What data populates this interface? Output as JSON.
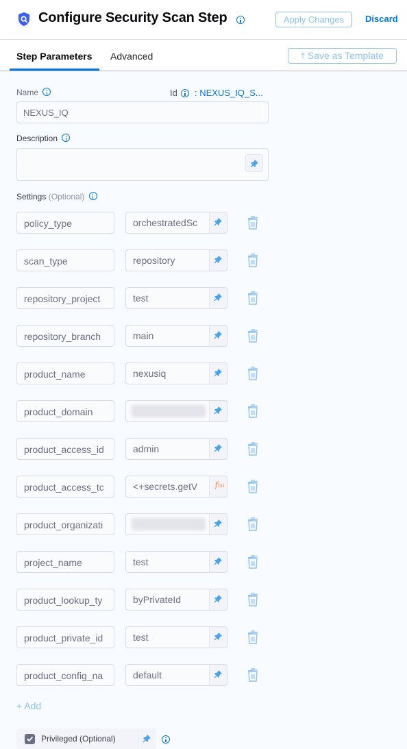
{
  "header": {
    "icon": "security-shield-icon",
    "title": "Configure Security Scan Step",
    "apply_label": "Apply Changes",
    "discard_label": "Discard"
  },
  "tabs": [
    {
      "label": "Step Parameters",
      "active": true
    },
    {
      "label": "Advanced",
      "active": false
    }
  ],
  "save_template_label": "Save as Template",
  "form": {
    "name_label": "Name",
    "name_value": "NEXUS_IQ",
    "id_label": "Id",
    "id_value": ": NEXUS_IQ_S...",
    "description_label": "Description",
    "description_value": "",
    "settings_label": "Settings",
    "settings_optional": "(Optional)"
  },
  "settings": [
    {
      "key": "policy_type",
      "value": "orchestratedSc",
      "mode": "pin"
    },
    {
      "key": "scan_type",
      "value": "repository",
      "mode": "pin"
    },
    {
      "key": "repository_project",
      "value": "test",
      "mode": "pin"
    },
    {
      "key": "repository_branch",
      "value": "main",
      "mode": "pin"
    },
    {
      "key": "product_name",
      "value": "nexusiq",
      "mode": "pin"
    },
    {
      "key": "product_domain",
      "value": "",
      "mode": "pin",
      "redacted": true
    },
    {
      "key": "product_access_id",
      "value": "admin",
      "mode": "pin"
    },
    {
      "key": "product_access_tc",
      "value": "<+secrets.getV",
      "mode": "expression"
    },
    {
      "key": "product_organizati",
      "value": "",
      "mode": "pin",
      "redacted": true
    },
    {
      "key": "project_name",
      "value": "test",
      "mode": "pin"
    },
    {
      "key": "product_lookup_ty",
      "value": "byPrivateId",
      "mode": "pin"
    },
    {
      "key": "product_private_id",
      "value": "test",
      "mode": "pin"
    },
    {
      "key": "product_config_na",
      "value": "default",
      "mode": "pin"
    }
  ],
  "add_label": "+ Add",
  "privileged": {
    "label": "Privileged (Optional)",
    "checked": true
  },
  "colors": {
    "accent": "#0278d5",
    "accent_light": "#8ec2ed",
    "expression": "#ff832b"
  }
}
